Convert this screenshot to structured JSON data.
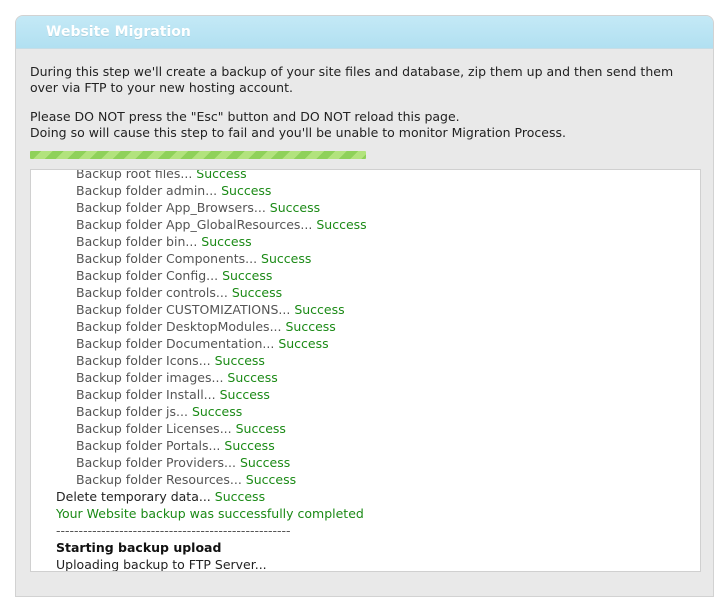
{
  "panel": {
    "title": "Website Migration",
    "intro_1": "During this step we'll create a backup of your site files and database, zip them up and then send them over via FTP to your new hosting account.",
    "intro_2a": "Please DO NOT press the \"Esc\" button and DO NOT reload this page.",
    "intro_2b": "Doing so will cause this step to fail and you'll be unable to monitor Migration Process."
  },
  "progress": {
    "value": 0.5
  },
  "log": {
    "folders": [
      {
        "label": "Backup root files...",
        "status": "Success"
      },
      {
        "label": "Backup folder admin...",
        "status": "Success"
      },
      {
        "label": "Backup folder App_Browsers...",
        "status": "Success"
      },
      {
        "label": "Backup folder App_GlobalResources...",
        "status": "Success"
      },
      {
        "label": "Backup folder bin...",
        "status": "Success"
      },
      {
        "label": "Backup folder Components...",
        "status": "Success"
      },
      {
        "label": "Backup folder Config...",
        "status": "Success"
      },
      {
        "label": "Backup folder controls...",
        "status": "Success"
      },
      {
        "label": "Backup folder CUSTOMIZATIONS...",
        "status": "Success"
      },
      {
        "label": "Backup folder DesktopModules...",
        "status": "Success"
      },
      {
        "label": "Backup folder Documentation...",
        "status": "Success"
      },
      {
        "label": "Backup folder Icons...",
        "status": "Success"
      },
      {
        "label": "Backup folder images...",
        "status": "Success"
      },
      {
        "label": "Backup folder Install...",
        "status": "Success"
      },
      {
        "label": "Backup folder js...",
        "status": "Success"
      },
      {
        "label": "Backup folder Licenses...",
        "status": "Success"
      },
      {
        "label": "Backup folder Portals...",
        "status": "Success"
      },
      {
        "label": "Backup folder Providers...",
        "status": "Success"
      },
      {
        "label": "Backup folder Resources...",
        "status": "Success"
      }
    ],
    "delete_label": "Delete temporary data...",
    "delete_status": "Success",
    "completed": "Your Website backup was successfully completed",
    "separator": "----------------------------------------------------",
    "upload_heading": "Starting backup upload",
    "upload_status": "Uploading backup to FTP Server..."
  }
}
